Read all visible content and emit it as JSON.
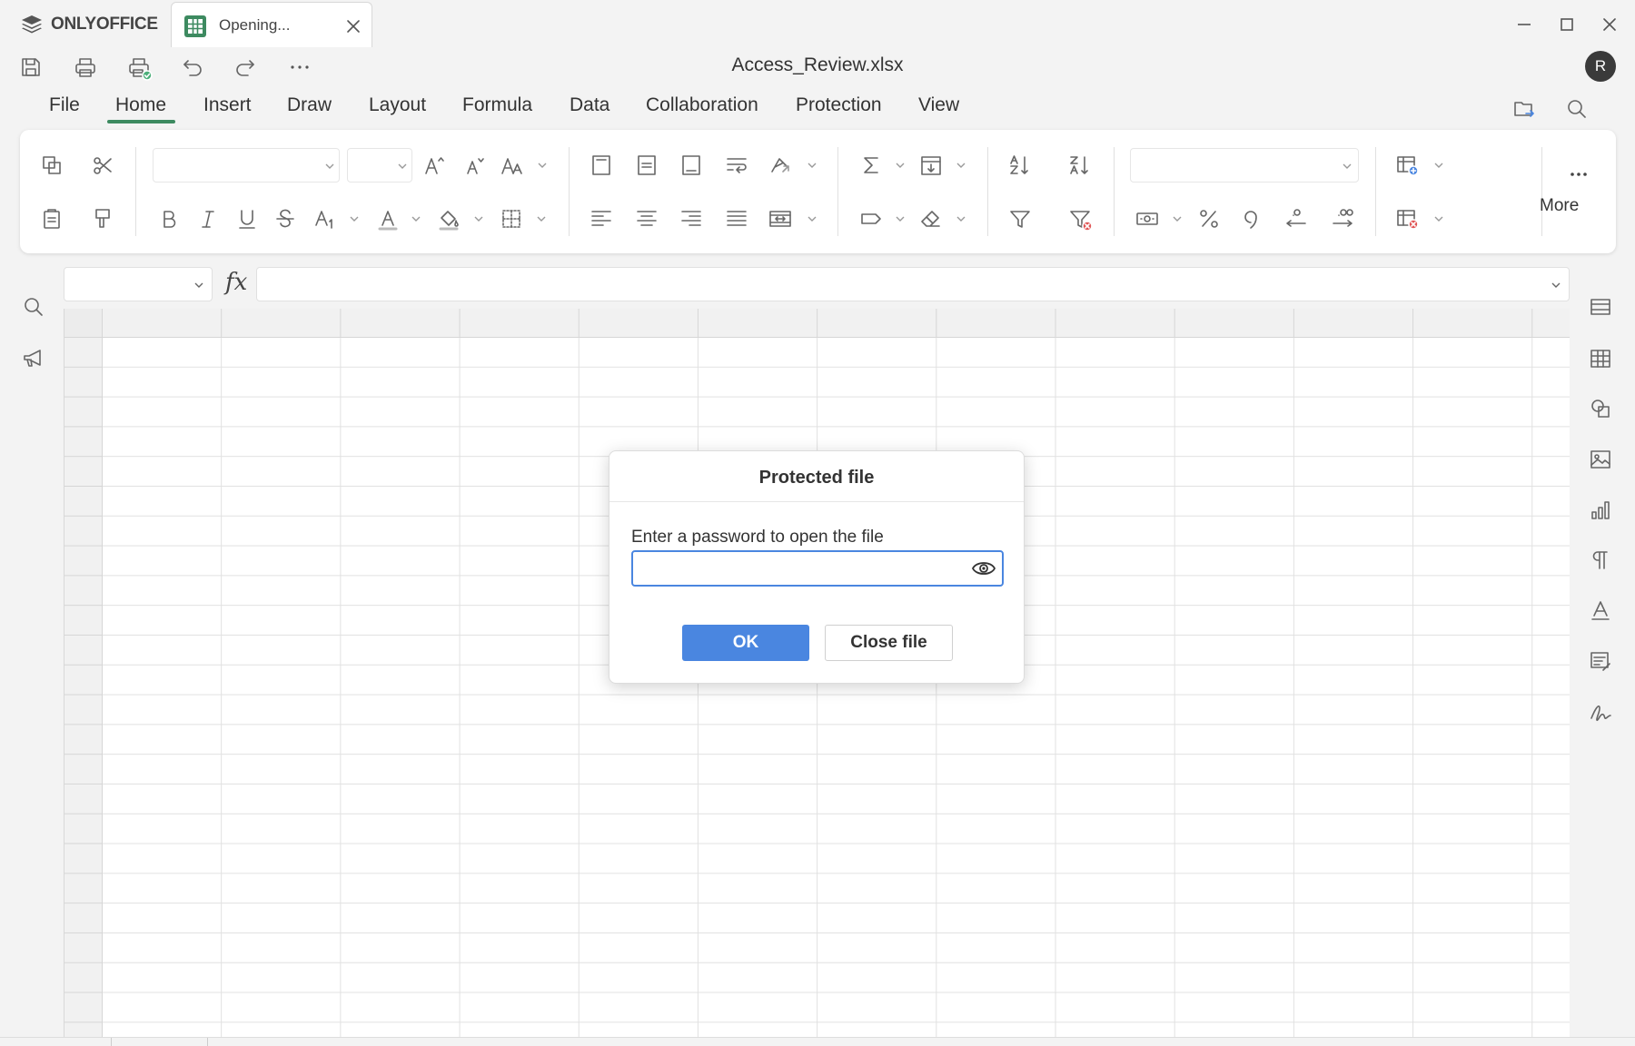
{
  "window": {
    "brand": "ONLYOFFICE",
    "tab_label": "Opening...",
    "doc_title": "Access_Review.xlsx",
    "avatar_initial": "R"
  },
  "menu": {
    "tabs": [
      "File",
      "Home",
      "Insert",
      "Draw",
      "Layout",
      "Formula",
      "Data",
      "Collaboration",
      "Protection",
      "View"
    ],
    "active_tab": "Home"
  },
  "toolbar": {
    "more_label": "More",
    "font_name": "",
    "font_size": ""
  },
  "formula_bar": {
    "fx_label": "fx",
    "name_box": "",
    "formula": ""
  },
  "dialog": {
    "title": "Protected file",
    "prompt": "Enter a password to open the file",
    "password_value": "",
    "ok_label": "OK",
    "close_label": "Close file"
  },
  "colors": {
    "accent_blue": "#4a86e0",
    "active_tab_underline": "#3d8a60",
    "sheet_icon_green": "#3d8a60"
  }
}
